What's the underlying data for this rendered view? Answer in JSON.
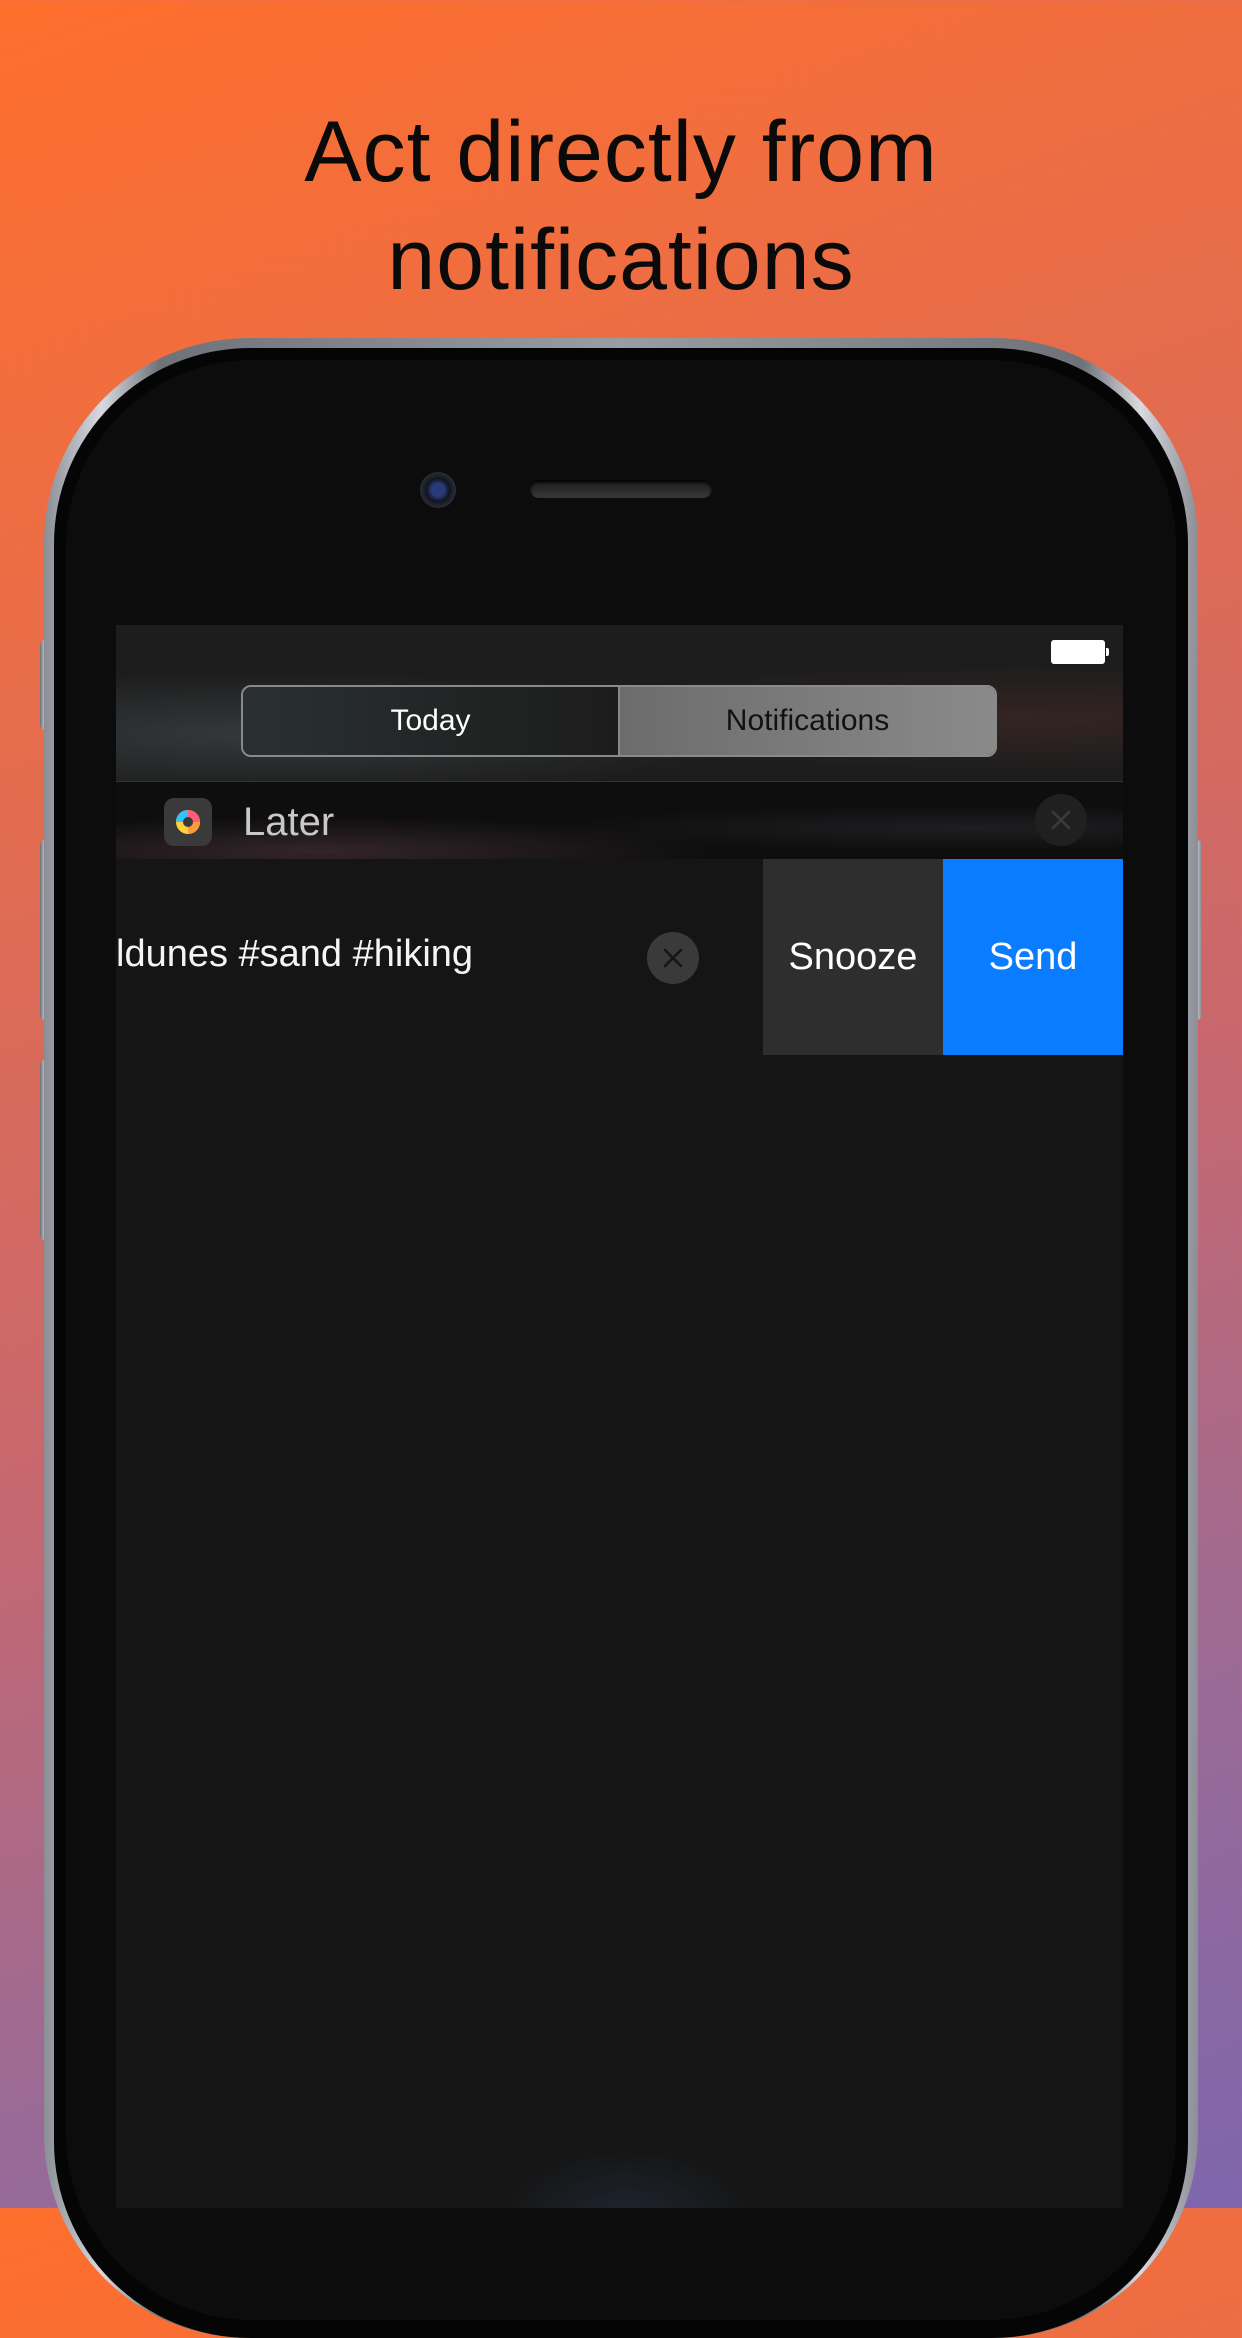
{
  "headline": {
    "line1": "Act directly from",
    "line2": "notifications"
  },
  "segmented_control": {
    "today_label": "Today",
    "notifications_label": "Notifications",
    "selected": "Notifications"
  },
  "notification_group": {
    "app_name": "Later",
    "app_icon": "later-app-icon",
    "clear_icon": "close-icon"
  },
  "notification": {
    "text": "ldunes #sand #hiking",
    "dismiss_icon": "close-icon",
    "actions": {
      "snooze_label": "Snooze",
      "send_label": "Send"
    }
  },
  "colors": {
    "send_blue": "#0a7cff",
    "snooze_gray": "#2e2e2e",
    "background_top": "#ff6e2c",
    "background_bottom": "#7e66ad"
  },
  "status_bar": {
    "battery_icon": "battery-icon"
  }
}
